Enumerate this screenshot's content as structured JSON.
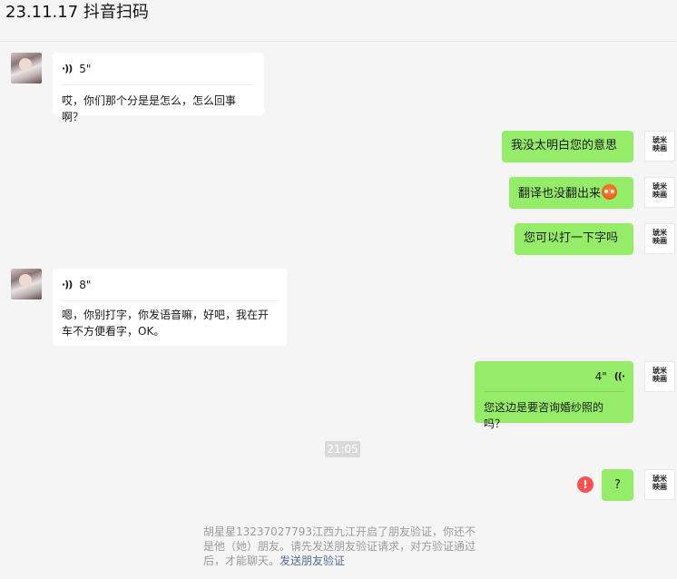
{
  "header": {
    "title": "23.11.17 抖音扫码",
    "more_label": "··· "
  },
  "brand_avatar": {
    "line1": "琥米",
    "line2": "映画",
    "tiny": "— —"
  },
  "messages": {
    "m1": {
      "duration": "5\"",
      "text": "哎，你们那个分是是怎么，怎么回事啊？"
    },
    "m2": {
      "text": "我没太明白您的意思"
    },
    "m3": {
      "text": "翻译也没翻出来"
    },
    "m4": {
      "text": "您可以打一下字吗"
    },
    "m5": {
      "duration": "8\"",
      "text": "嗯，你别打字，你发语音嘛，好吧，我在开车不方便看字，OK。"
    },
    "m6": {
      "duration": "4\"",
      "text": "您这边是要咨询婚纱照的吗？"
    },
    "m7": {
      "text": "?"
    }
  },
  "time_divider": "21:05",
  "notice": {
    "text": "胡星星13237027793江西九江开启了朋友验证，你还不是他（她）朋友。请先发送朋友验证请求，对方验证通过后，才能聊天。",
    "link": "发送朋友验证"
  },
  "colors": {
    "bubble_out": "#95ec69",
    "bubble_in": "#ffffff",
    "background": "#f5f5f5",
    "error": "#fa5151",
    "link": "#576b95"
  }
}
